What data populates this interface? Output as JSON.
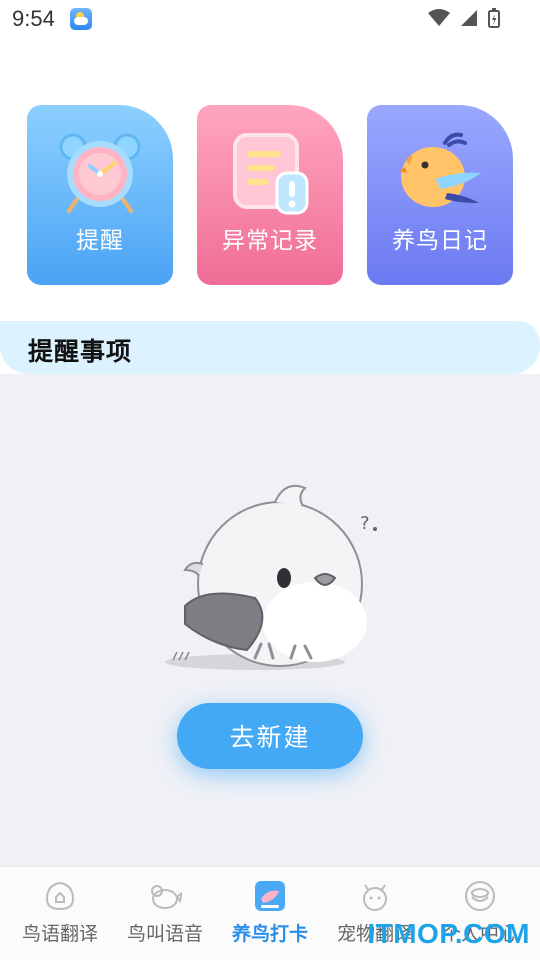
{
  "status_bar": {
    "time": "9:54"
  },
  "cards": [
    {
      "label": "提醒"
    },
    {
      "label": "异常记录"
    },
    {
      "label": "养鸟日记"
    }
  ],
  "section": {
    "title": "提醒事项"
  },
  "empty_state": {
    "button_label": "去新建"
  },
  "nav": {
    "items": [
      {
        "label": "鸟语翻译",
        "icon": "bird-talk-icon"
      },
      {
        "label": "鸟叫语音",
        "icon": "bird-call-icon"
      },
      {
        "label": "养鸟打卡",
        "icon": "checkin-icon",
        "active": true
      },
      {
        "label": "宠物翻译",
        "icon": "pet-icon"
      },
      {
        "label": "个人中心",
        "icon": "profile-icon"
      }
    ]
  },
  "watermark": "ITMOP.COM",
  "colors": {
    "accent": "#43a9f5",
    "active_nav": "#2a8fe8"
  }
}
